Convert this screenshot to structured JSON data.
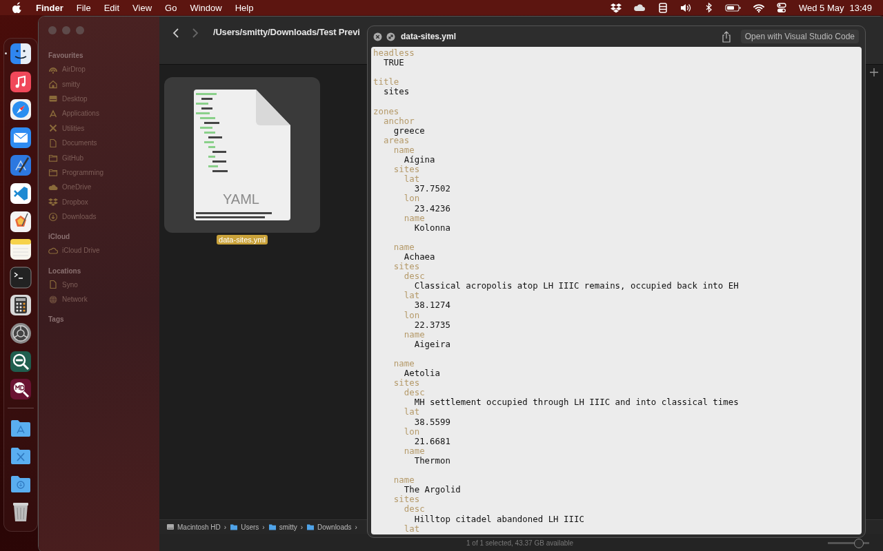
{
  "menu_bar": {
    "app": "Finder",
    "menus": [
      "File",
      "Edit",
      "View",
      "Go",
      "Window",
      "Help"
    ],
    "status_icons": [
      {
        "kind": "dropbox"
      },
      {
        "kind": "cloud"
      },
      {
        "kind": "storage"
      },
      {
        "kind": "volume"
      },
      {
        "kind": "bluetooth"
      },
      {
        "kind": "battery"
      },
      {
        "kind": "wifi"
      },
      {
        "kind": "controls"
      }
    ],
    "date": "Wed 5 May",
    "time": "13:49"
  },
  "dock": {
    "items": [
      {
        "kind": "finder",
        "running": true
      },
      {
        "kind": "music",
        "running": false
      },
      {
        "kind": "safari",
        "running": false
      },
      {
        "kind": "mail",
        "running": false
      },
      {
        "kind": "xcode",
        "running": false
      },
      {
        "kind": "vscode",
        "running": false
      },
      {
        "kind": "pixelmator",
        "running": false
      },
      {
        "kind": "notes",
        "running": false
      },
      {
        "kind": "terminal",
        "running": false
      },
      {
        "kind": "calculator",
        "running": false
      },
      {
        "kind": "settings",
        "running": false
      },
      {
        "kind": "yaml-viewer",
        "running": false
      },
      {
        "kind": "md-viewer",
        "running": false
      },
      {
        "kind": "separator"
      },
      {
        "kind": "folder-apps",
        "running": false
      },
      {
        "kind": "folder-tools",
        "running": false
      },
      {
        "kind": "folder-downloads",
        "running": false
      },
      {
        "kind": "trash",
        "running": false
      }
    ]
  },
  "finder": {
    "sidebar": {
      "sections": [
        {
          "title": "Favourites",
          "items": [
            {
              "label": "AirDrop",
              "kind": "airdrop"
            },
            {
              "label": "smitty",
              "kind": "home"
            },
            {
              "label": "Desktop",
              "kind": "desktop"
            },
            {
              "label": "Applications",
              "kind": "apps"
            },
            {
              "label": "Utilities",
              "kind": "tools"
            },
            {
              "label": "Documents",
              "kind": "doc"
            },
            {
              "label": "GitHub",
              "kind": "folder"
            },
            {
              "label": "Programming",
              "kind": "folder"
            },
            {
              "label": "OneDrive",
              "kind": "cloud"
            },
            {
              "label": "Dropbox",
              "kind": "dropbox"
            },
            {
              "label": "Downloads",
              "kind": "download"
            }
          ]
        },
        {
          "title": "iCloud",
          "items": [
            {
              "label": "iCloud Drive",
              "kind": "cloud-outline"
            }
          ]
        },
        {
          "title": "Locations",
          "items": [
            {
              "label": "Syno",
              "kind": "doc"
            },
            {
              "label": "Network",
              "kind": "globe"
            }
          ]
        },
        {
          "title": "Tags"
        }
      ]
    },
    "toolbar": {
      "path_title": "/Users/smitty/Downloads/Test Previ"
    },
    "files": [
      {
        "name": "data-sites.yml",
        "type_label": "YAML",
        "selected": true
      }
    ],
    "path_bar": {
      "separator": "›",
      "items": [
        {
          "label": "Macintosh HD",
          "kind": "disk"
        },
        {
          "label": "Users",
          "kind": "folder"
        },
        {
          "label": "smitty",
          "kind": "folder"
        },
        {
          "label": "Downloads",
          "kind": "folder"
        }
      ]
    },
    "status": "1 of 1 selected, 43.37 GB available",
    "icon_size_slider": {
      "level": 0.75
    }
  },
  "quick_look": {
    "title": "data-sites.yml",
    "open_button": "Open with Visual Studio Code",
    "lines": [
      {
        "kind": "key",
        "text": "headless"
      },
      {
        "kind": "value",
        "text": "  TRUE"
      },
      {
        "kind": "blank"
      },
      {
        "kind": "key",
        "text": "title"
      },
      {
        "kind": "value",
        "text": "  sites"
      },
      {
        "kind": "blank"
      },
      {
        "kind": "key",
        "text": "zones"
      },
      {
        "kind": "key",
        "text": "  anchor"
      },
      {
        "kind": "value",
        "text": "    greece"
      },
      {
        "kind": "key",
        "text": "  areas"
      },
      {
        "kind": "key",
        "text": "    name"
      },
      {
        "kind": "value",
        "text": "      Aígina"
      },
      {
        "kind": "key",
        "text": "    sites"
      },
      {
        "kind": "key",
        "text": "      lat"
      },
      {
        "kind": "value",
        "text": "        37.7502"
      },
      {
        "kind": "key",
        "text": "      lon"
      },
      {
        "kind": "value",
        "text": "        23.4236"
      },
      {
        "kind": "key",
        "text": "      name"
      },
      {
        "kind": "value",
        "text": "        Kolonna"
      },
      {
        "kind": "blank"
      },
      {
        "kind": "key",
        "text": "    name"
      },
      {
        "kind": "value",
        "text": "      Achaea"
      },
      {
        "kind": "key",
        "text": "    sites"
      },
      {
        "kind": "key",
        "text": "      desc"
      },
      {
        "kind": "value",
        "text": "        Classical acropolis atop LH IIIC remains, occupied back into EH"
      },
      {
        "kind": "key",
        "text": "      lat"
      },
      {
        "kind": "value",
        "text": "        38.1274"
      },
      {
        "kind": "key",
        "text": "      lon"
      },
      {
        "kind": "value",
        "text": "        22.3735"
      },
      {
        "kind": "key",
        "text": "      name"
      },
      {
        "kind": "value",
        "text": "        Aigeira"
      },
      {
        "kind": "blank"
      },
      {
        "kind": "key",
        "text": "    name"
      },
      {
        "kind": "value",
        "text": "      Aetolia"
      },
      {
        "kind": "key",
        "text": "    sites"
      },
      {
        "kind": "key",
        "text": "      desc"
      },
      {
        "kind": "value",
        "text": "        MH settlement occupied through LH IIIC and into classical times"
      },
      {
        "kind": "key",
        "text": "      lat"
      },
      {
        "kind": "value",
        "text": "        38.5599"
      },
      {
        "kind": "key",
        "text": "      lon"
      },
      {
        "kind": "value",
        "text": "        21.6681"
      },
      {
        "kind": "key",
        "text": "      name"
      },
      {
        "kind": "value",
        "text": "        Thermon"
      },
      {
        "kind": "blank"
      },
      {
        "kind": "key",
        "text": "    name"
      },
      {
        "kind": "value",
        "text": "      The Argolid"
      },
      {
        "kind": "key",
        "text": "    sites"
      },
      {
        "kind": "key",
        "text": "      desc"
      },
      {
        "kind": "value",
        "text": "        Hilltop citadel abandoned LH IIIC"
      },
      {
        "kind": "key",
        "text": "      lat"
      }
    ]
  }
}
